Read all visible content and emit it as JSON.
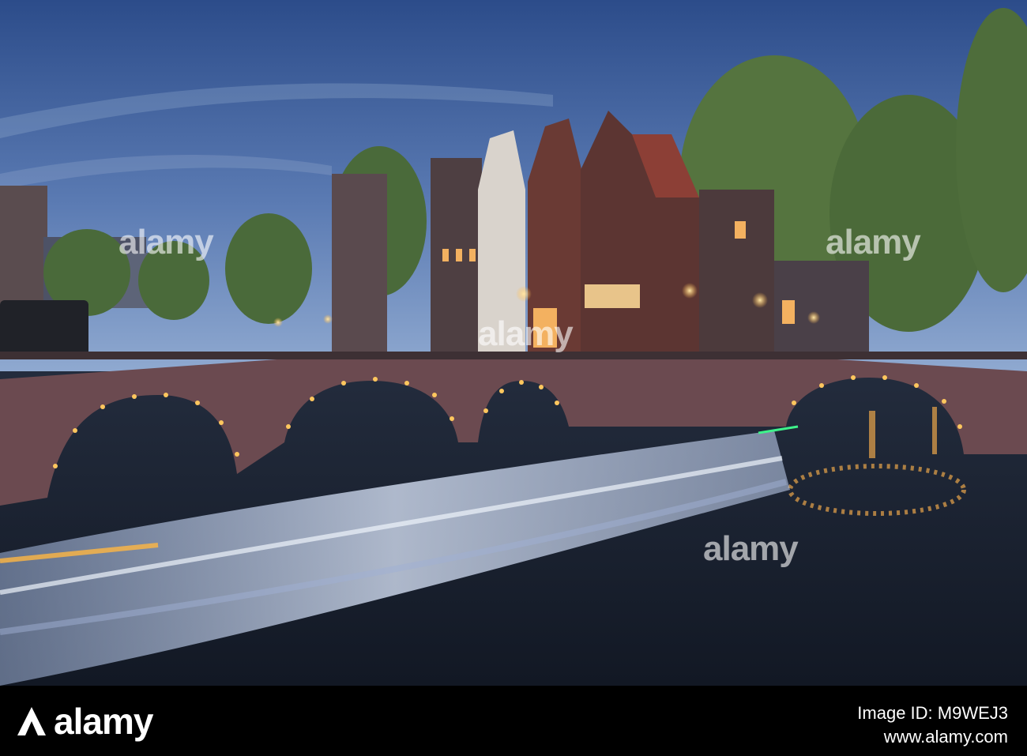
{
  "photo": {
    "subject": "night canal scene",
    "colors": {
      "sky_top": "#2e4f8e",
      "sky_bottom": "#7f9fcb",
      "brick": "#6b4a4f",
      "water": "#1b2432",
      "light": "#ffc35a",
      "boat_blur": "#c7d6ef",
      "tree": "#4c6a3c"
    }
  },
  "watermarks": {
    "word": "alamy",
    "icon": "alamy-a-icon"
  },
  "footer": {
    "logo_text": "alamy",
    "image_id": "Image ID: M9WEJ3",
    "site": "www.alamy.com"
  }
}
